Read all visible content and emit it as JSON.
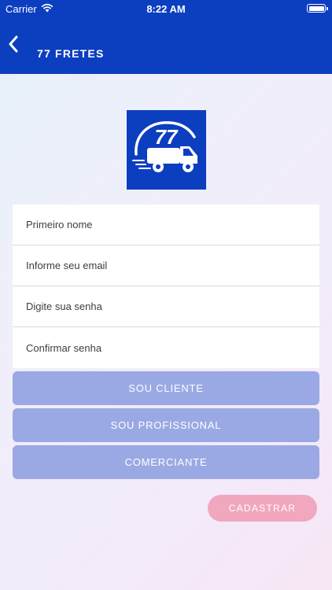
{
  "status_bar": {
    "carrier": "Carrier",
    "time": "8:22 AM",
    "wifi_icon": "wifi-icon",
    "battery_icon": "battery-icon"
  },
  "nav": {
    "back_icon": "chevron-left-icon",
    "title": "77 FRETES"
  },
  "logo": {
    "text": "77",
    "icon": "truck-icon"
  },
  "form": {
    "first_name_placeholder": "Primeiro nome",
    "email_placeholder": "Informe seu email",
    "password_placeholder": "Digite sua senha",
    "confirm_password_placeholder": "Confirmar senha"
  },
  "roles": {
    "client": "SOU CLIENTE",
    "professional": "SOU PROFISSIONAL",
    "merchant": "COMERCIANTE"
  },
  "submit_label": "CADASTRAR",
  "colors": {
    "brand_blue": "#0c3ec0",
    "role_button": "#9aa9e4",
    "submit_button": "#f1a7be"
  }
}
